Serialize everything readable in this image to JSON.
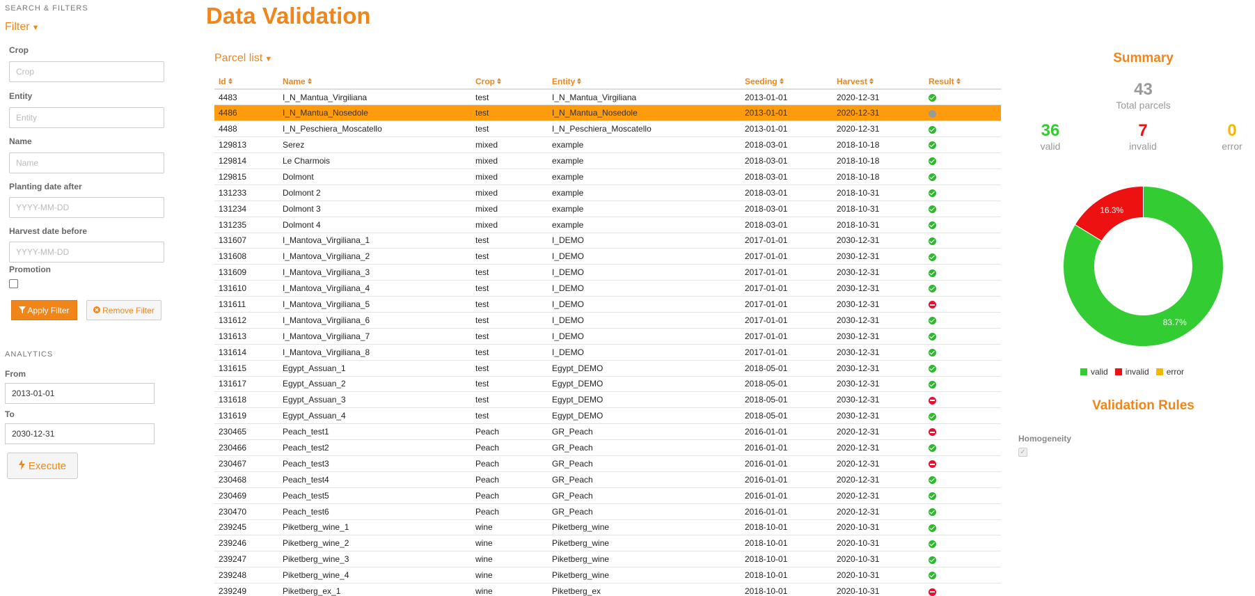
{
  "sidebar": {
    "search_section": "SEARCH & FILTERS",
    "filter_toggle": "Filter",
    "fields": {
      "crop": {
        "label": "Crop",
        "placeholder": "Crop"
      },
      "entity": {
        "label": "Entity",
        "placeholder": "Entity"
      },
      "name": {
        "label": "Name",
        "placeholder": "Name"
      },
      "planting_after": {
        "label": "Planting date after",
        "placeholder": "YYYY-MM-DD"
      },
      "harvest_before": {
        "label": "Harvest date before",
        "placeholder": "YYYY-MM-DD"
      },
      "promotion": {
        "label": "Promotion"
      }
    },
    "apply_filter": "Apply Filter",
    "remove_filter": "Remove Filter",
    "analytics_section": "ANALYTICS",
    "from_label": "From",
    "from_value": "2013-01-01",
    "to_label": "To",
    "to_value": "2030-12-31",
    "execute": "Execute"
  },
  "main": {
    "title": "Data Validation",
    "parcel_list": "Parcel list",
    "columns": [
      "Id",
      "Name",
      "Crop",
      "Entity",
      "Seeding",
      "Harvest",
      "Result"
    ],
    "rows": [
      [
        "4483",
        "I_N_Mantua_Virgiliana",
        "test",
        "I_N_Mantua_Virgiliana",
        "2013-01-01",
        "2020-12-31",
        "valid"
      ],
      [
        "4486",
        "I_N_Mantua_Nosedole",
        "test",
        "I_N_Mantua_Nosedole",
        "2013-01-01",
        "2020-12-31",
        "pending"
      ],
      [
        "4488",
        "I_N_Peschiera_Moscatello",
        "test",
        "I_N_Peschiera_Moscatello",
        "2013-01-01",
        "2020-12-31",
        "valid"
      ],
      [
        "129813",
        "Serez",
        "mixed",
        "example",
        "2018-03-01",
        "2018-10-18",
        "valid"
      ],
      [
        "129814",
        "Le Charmois",
        "mixed",
        "example",
        "2018-03-01",
        "2018-10-18",
        "valid"
      ],
      [
        "129815",
        "Dolmont",
        "mixed",
        "example",
        "2018-03-01",
        "2018-10-18",
        "valid"
      ],
      [
        "131233",
        "Dolmont 2",
        "mixed",
        "example",
        "2018-03-01",
        "2018-10-31",
        "valid"
      ],
      [
        "131234",
        "Dolmont 3",
        "mixed",
        "example",
        "2018-03-01",
        "2018-10-31",
        "valid"
      ],
      [
        "131235",
        "Dolmont 4",
        "mixed",
        "example",
        "2018-03-01",
        "2018-10-31",
        "valid"
      ],
      [
        "131607",
        "I_Mantova_Virgiliana_1",
        "test",
        "I_DEMO",
        "2017-01-01",
        "2030-12-31",
        "valid"
      ],
      [
        "131608",
        "I_Mantova_Virgiliana_2",
        "test",
        "I_DEMO",
        "2017-01-01",
        "2030-12-31",
        "valid"
      ],
      [
        "131609",
        "I_Mantova_Virgiliana_3",
        "test",
        "I_DEMO",
        "2017-01-01",
        "2030-12-31",
        "valid"
      ],
      [
        "131610",
        "I_Mantova_Virgiliana_4",
        "test",
        "I_DEMO",
        "2017-01-01",
        "2030-12-31",
        "valid"
      ],
      [
        "131611",
        "I_Mantova_Virgiliana_5",
        "test",
        "I_DEMO",
        "2017-01-01",
        "2030-12-31",
        "invalid"
      ],
      [
        "131612",
        "I_Mantova_Virgiliana_6",
        "test",
        "I_DEMO",
        "2017-01-01",
        "2030-12-31",
        "valid"
      ],
      [
        "131613",
        "I_Mantova_Virgiliana_7",
        "test",
        "I_DEMO",
        "2017-01-01",
        "2030-12-31",
        "valid"
      ],
      [
        "131614",
        "I_Mantova_Virgiliana_8",
        "test",
        "I_DEMO",
        "2017-01-01",
        "2030-12-31",
        "valid"
      ],
      [
        "131615",
        "Egypt_Assuan_1",
        "test",
        "Egypt_DEMO",
        "2018-05-01",
        "2030-12-31",
        "valid"
      ],
      [
        "131617",
        "Egypt_Assuan_2",
        "test",
        "Egypt_DEMO",
        "2018-05-01",
        "2030-12-31",
        "valid"
      ],
      [
        "131618",
        "Egypt_Assuan_3",
        "test",
        "Egypt_DEMO",
        "2018-05-01",
        "2030-12-31",
        "invalid"
      ],
      [
        "131619",
        "Egypt_Assuan_4",
        "test",
        "Egypt_DEMO",
        "2018-05-01",
        "2030-12-31",
        "valid"
      ],
      [
        "230465",
        "Peach_test1",
        "Peach",
        "GR_Peach",
        "2016-01-01",
        "2020-12-31",
        "invalid"
      ],
      [
        "230466",
        "Peach_test2",
        "Peach",
        "GR_Peach",
        "2016-01-01",
        "2020-12-31",
        "valid"
      ],
      [
        "230467",
        "Peach_test3",
        "Peach",
        "GR_Peach",
        "2016-01-01",
        "2020-12-31",
        "invalid"
      ],
      [
        "230468",
        "Peach_test4",
        "Peach",
        "GR_Peach",
        "2016-01-01",
        "2020-12-31",
        "valid"
      ],
      [
        "230469",
        "Peach_test5",
        "Peach",
        "GR_Peach",
        "2016-01-01",
        "2020-12-31",
        "valid"
      ],
      [
        "230470",
        "Peach_test6",
        "Peach",
        "GR_Peach",
        "2016-01-01",
        "2020-12-31",
        "valid"
      ],
      [
        "239245",
        "Piketberg_wine_1",
        "wine",
        "Piketberg_wine",
        "2018-10-01",
        "2020-10-31",
        "valid"
      ],
      [
        "239246",
        "Piketberg_wine_2",
        "wine",
        "Piketberg_wine",
        "2018-10-01",
        "2020-10-31",
        "valid"
      ],
      [
        "239247",
        "Piketberg_wine_3",
        "wine",
        "Piketberg_wine",
        "2018-10-01",
        "2020-10-31",
        "valid"
      ],
      [
        "239248",
        "Piketberg_wine_4",
        "wine",
        "Piketberg_wine",
        "2018-10-01",
        "2020-10-31",
        "valid"
      ],
      [
        "239249",
        "Piketberg_ex_1",
        "wine",
        "Piketberg_ex",
        "2018-10-01",
        "2020-10-31",
        "invalid"
      ]
    ],
    "selected_row": 1
  },
  "summary": {
    "title": "Summary",
    "total": "43",
    "total_label": "Total parcels",
    "valid": "36",
    "valid_label": "valid",
    "invalid": "7",
    "invalid_label": "invalid",
    "error": "0",
    "error_label": "error",
    "rules_title": "Validation Rules",
    "homogeneity_label": "Homogeneity"
  },
  "colors": {
    "accent": "#f0861a",
    "valid": "#33cc33",
    "invalid": "#ee1111",
    "error": "#f5b800",
    "selected_row": "#ff9c0e"
  },
  "chart_data": {
    "type": "pie",
    "donut": true,
    "categories": [
      "valid",
      "invalid",
      "error"
    ],
    "values": [
      36,
      7,
      0
    ],
    "labels": [
      "83.7%",
      "16.3%",
      ""
    ],
    "legend": [
      "valid",
      "invalid",
      "error"
    ],
    "legend_position": "bottom"
  }
}
